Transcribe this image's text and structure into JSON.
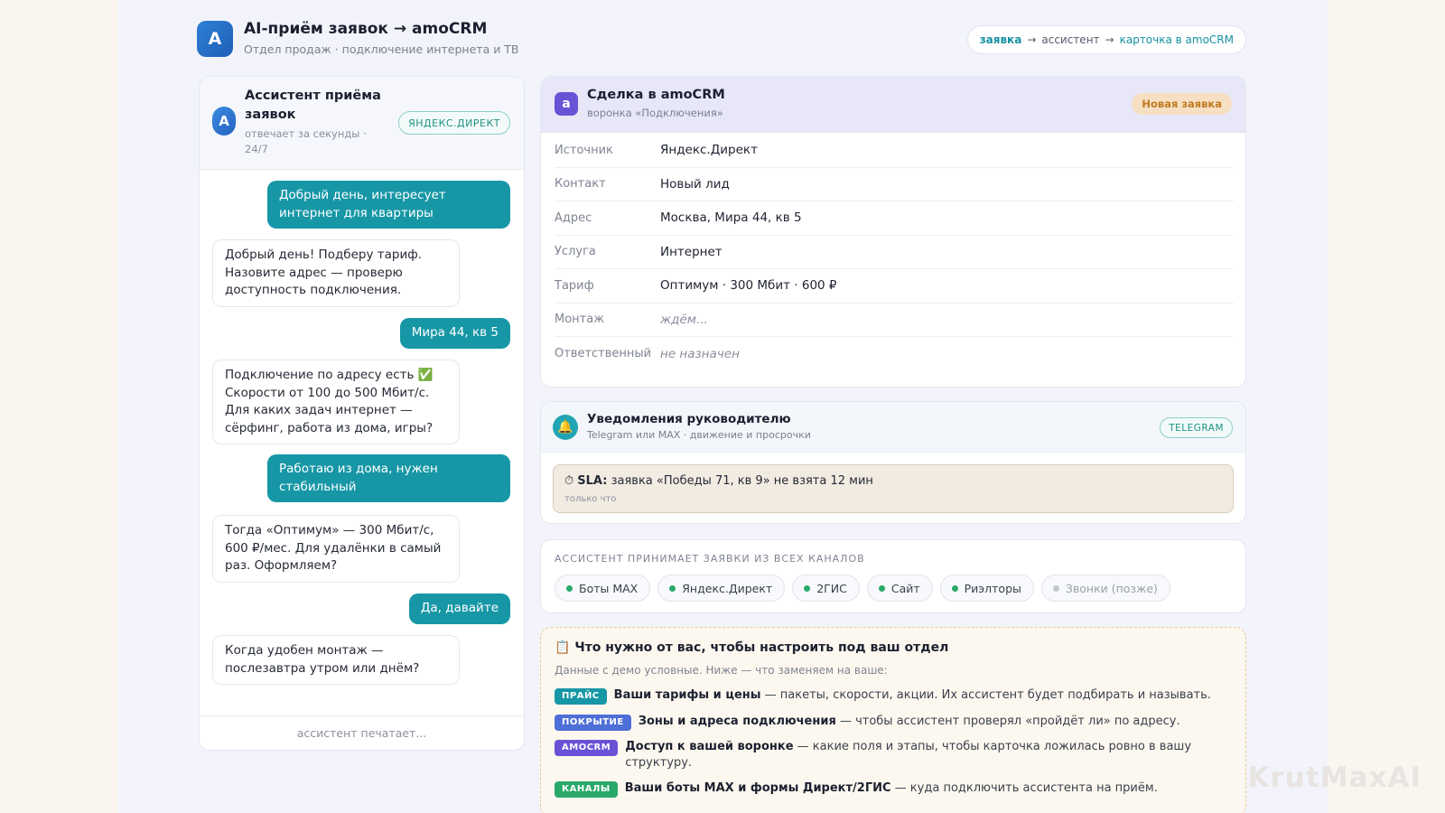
{
  "header": {
    "logo": "A",
    "title": "AI-приём заявок → amoCRM",
    "subtitle": "Отдел продаж · подключение интернета и ТВ",
    "flow": {
      "step1": "заявка",
      "arrow1": "→",
      "step2": "ассистент",
      "arrow2": "→",
      "step3": "карточка в amoCRM"
    }
  },
  "chat": {
    "avatar": "A",
    "name": "Ассистент приёма заявок",
    "status": "отвечает за секунды · 24/7",
    "badge": "ЯНДЕКС.ДИРЕКТ",
    "messages": [
      {
        "from": "user",
        "text": "Добрый день, интересует интернет для квартиры"
      },
      {
        "from": "bot",
        "text": "Добрый день! Подберу тариф. Назовите адрес — проверю доступность подключения."
      },
      {
        "from": "user",
        "text": "Мира 44, кв 5"
      },
      {
        "from": "bot",
        "text": "Подключение по адресу есть ✅ Скорости от 100 до 500 Мбит/с. Для каких задач интернет — сёрфинг, работа из дома, игры?"
      },
      {
        "from": "user",
        "text": "Работаю из дома, нужен стабильный"
      },
      {
        "from": "bot",
        "text": "Тогда «Оптимум» — 300 Мбит/с, 600 ₽/мес. Для удалёнки в самый раз. Оформляем?"
      },
      {
        "from": "user",
        "text": "Да, давайте"
      },
      {
        "from": "bot",
        "text": "Когда удобен монтаж — послезавтра утром или днём?"
      }
    ],
    "typing": "ассистент печатает..."
  },
  "deal": {
    "icon": "a",
    "title": "Сделка в amoCRM",
    "subtitle": "воронка «Подключения»",
    "status": "Новая заявка",
    "rows": [
      {
        "key": "Источник",
        "value": "Яндекс.Директ"
      },
      {
        "key": "Контакт",
        "value": "Новый лид"
      },
      {
        "key": "Адрес",
        "value": "Москва, Мира 44, кв 5"
      },
      {
        "key": "Услуга",
        "value": "Интернет"
      },
      {
        "key": "Тариф",
        "value": "Оптимум · 300 Мбит · 600 ₽"
      },
      {
        "key": "Монтаж",
        "value": "ждём..."
      },
      {
        "key": "Ответственный",
        "value": "не назначен"
      }
    ]
  },
  "notifications": {
    "icon": "bell-icon",
    "title": "Уведомления руководителю",
    "subtitle": "Telegram или MAX · движение и просрочки",
    "badge": "TELEGRAM",
    "alert": {
      "icon": "⏱",
      "label": "SLA:",
      "text": "заявка «Победы 71, кв 9» не взята 12 мин",
      "time": "только что"
    }
  },
  "channels": {
    "title": "АССИСТЕНТ ПРИНИМАЕТ ЗАЯВКИ ИЗ ВСЕХ КАНАЛОВ",
    "items": [
      {
        "label": "Боты MAX",
        "active": true
      },
      {
        "label": "Яндекс.Директ",
        "active": true
      },
      {
        "label": "2ГИС",
        "active": true
      },
      {
        "label": "Сайт",
        "active": true
      },
      {
        "label": "Риэлторы",
        "active": true
      },
      {
        "label": "Звонки (позже)",
        "active": false
      }
    ]
  },
  "setup": {
    "icon": "📋",
    "title": "Что нужно от вас, чтобы настроить под ваш отдел",
    "subtitle": "Данные с демо условные. Ниже — что заменяем на ваше:",
    "items": [
      {
        "tag": "ПРАЙС",
        "color": "#1797a6",
        "bold": "Ваши тарифы и цены",
        "text": " — пакеты, скорости, акции. Их ассистент будет подбирать и называть."
      },
      {
        "tag": "ПОКРЫТИЕ",
        "color": "#4f6fd8",
        "bold": "Зоны и адреса подключения",
        "text": " — чтобы ассистент проверял «пройдёт ли» по адресу."
      },
      {
        "tag": "AMOCRM",
        "color": "#6a52d6",
        "bold": "Доступ к вашей воронке",
        "text": " — какие поля и этапы, чтобы карточка ложилась ровно в вашу структуру."
      },
      {
        "tag": "КАНАЛЫ",
        "color": "#2aa86a",
        "bold": "Ваши боты MAX и формы Директ/2ГИС",
        "text": " — куда подключить ассистента на приём."
      }
    ]
  },
  "watermark": "KrutMaxAI"
}
